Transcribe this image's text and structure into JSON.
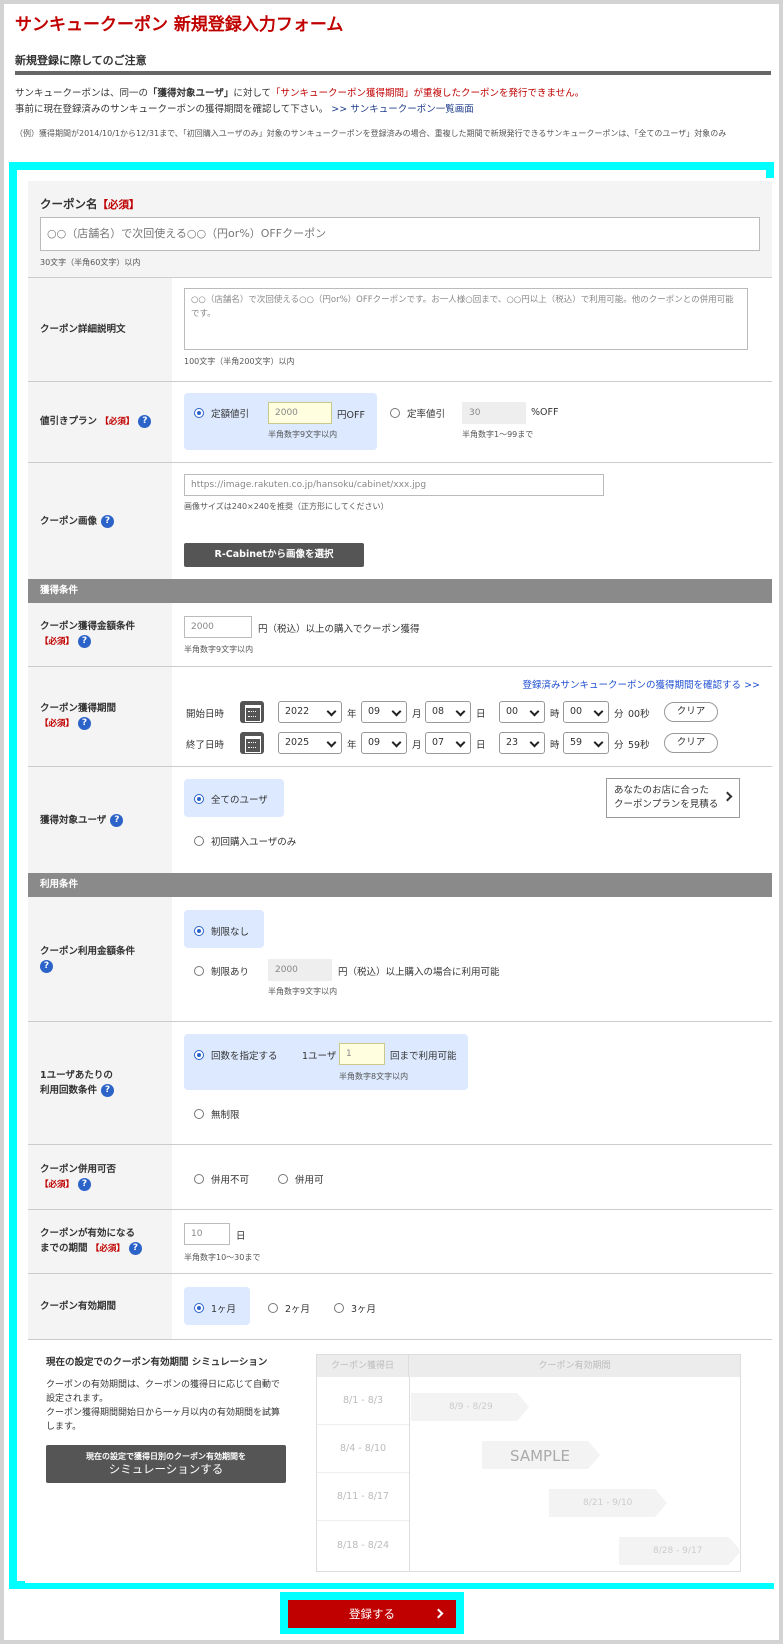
{
  "title": "サンキュークーポン 新規登録入力フォーム",
  "notice": {
    "heading": "新規登録に際してのご注意",
    "l1_a": "サンキュークーポンは、同一の",
    "l1_b": "「獲得対象ユーザ」",
    "l1_c": "に対して",
    "l1_d": "「サンキュークーポン獲得期間」が重複したクーポンを発行できません。",
    "l2_a": "事前に現在登録済みのサンキュークーポンの獲得期間を確認して下さい。",
    "l2_link": ">> サンキュークーポン一覧画面",
    "example": "（例）獲得期間が2014/10/1から12/31まで、「初回購入ユーザのみ」対象のサンキュークーポンを登録済みの場合、重複した期間で新規発行できるサンキュークーポンは、「全てのユーザ」対象のみ"
  },
  "coupon_name": {
    "label": "クーポン名",
    "req": "【必須】",
    "placeholder": "○○（店舗名）で次回使える○○（円or%）OFFクーポン",
    "hint": "30文字（半角60文字）以内"
  },
  "detail": {
    "label": "クーポン詳細説明文",
    "placeholder": "○○（店舗名）で次回使える○○（円or%）OFFクーポンです。お一人様○回まで、○○円以上（税込）で利用可能。他のクーポンとの併用可能です。",
    "hint": "100文字（半角200文字）以内"
  },
  "discount": {
    "label": "値引きプラン",
    "req": "【必須】",
    "fixed_label": "定額値引",
    "fixed_value": "2000",
    "fixed_unit": "円OFF",
    "fixed_hint": "半角数字9文字以内",
    "rate_label": "定率値引",
    "rate_value": "30",
    "rate_unit": "%OFF",
    "rate_hint": "半角数字1～99まで"
  },
  "image": {
    "label": "クーポン画像",
    "url": "https://image.rakuten.co.jp/hansoku/cabinet/xxx.jpg",
    "hint": "画像サイズは240×240を推奨（正方形にしてください）",
    "button": "R-Cabinetから画像を選択"
  },
  "acq_bar": "獲得条件",
  "amount": {
    "label": "クーポン獲得金額条件",
    "req": "【必須】",
    "value": "2000",
    "suffix": "円（税込）以上の購入でクーポン獲得",
    "hint": "半角数字9文字以内"
  },
  "period": {
    "label": "クーポン獲得期間",
    "req": "【必須】",
    "link": "登録済みサンキュークーポンの獲得期間を確認する >>",
    "start_label": "開始日時",
    "end_label": "終了日時",
    "start": {
      "year": "2022",
      "month": "09",
      "day": "08",
      "hour": "00",
      "min": "00",
      "sec": "00秒"
    },
    "end": {
      "year": "2025",
      "month": "09",
      "day": "07",
      "hour": "23",
      "min": "59",
      "sec": "59秒"
    },
    "u_year": "年",
    "u_month": "月",
    "u_day": "日",
    "u_hour": "時",
    "u_min": "分",
    "clear": "クリア"
  },
  "target": {
    "label": "獲得対象ユーザ",
    "opt_all": "全てのユーザ",
    "opt_first": "初回購入ユーザのみ",
    "estimate_l1": "あなたのお店に合った",
    "estimate_l2": "クーポンプランを見積る"
  },
  "use_bar": "利用条件",
  "use_amount": {
    "label": "クーポン利用金額条件",
    "opt_none": "制限なし",
    "opt_limit": "制限あり",
    "value": "2000",
    "suffix": "円（税込）以上購入の場合に利用可能",
    "hint": "半角数字9文字以内"
  },
  "use_count": {
    "label_l1": "1ユーザあたりの",
    "label_l2": "利用回数条件",
    "opt_count": "回数を指定する",
    "per_user": "1ユーザ",
    "value": "1",
    "suffix": "回まで利用可能",
    "hint": "半角数字8文字以内",
    "opt_unlimited": "無制限"
  },
  "combine": {
    "label": "クーポン併用可否",
    "req": "【必須】",
    "opt_no": "併用不可",
    "opt_yes": "併用可"
  },
  "start_days": {
    "label_l1": "クーポンが有効になる",
    "label_l2": "までの期間",
    "req": "【必須】",
    "value": "10",
    "unit": "日",
    "hint": "半角数字10～30まで"
  },
  "valid": {
    "label": "クーポン有効期間",
    "opt1": "1ヶ月",
    "opt2": "2ヶ月",
    "opt3": "3ヶ月"
  },
  "sim": {
    "heading": "現在の設定でのクーポン有効期間 シミュレーション",
    "desc1": "クーポンの有効期間は、クーポンの獲得日に応じて自動で設定されます。",
    "desc2": "クーポン獲得期間開始日から一ヶ月以内の有効期間を試算します。",
    "btn_l1": "現在の設定で獲得日別のクーポン有効期間を",
    "btn_l2": "シミュレーションする",
    "col1": "クーポン獲得日",
    "col2": "クーポン有効期間",
    "rows": [
      {
        "acq": "8/1 - 8/3",
        "valid": "8/9 - 8/29"
      },
      {
        "acq": "8/4 - 8/10",
        "valid": ""
      },
      {
        "acq": "8/11 - 8/17",
        "valid": "8/21 - 9/10"
      },
      {
        "acq": "8/18 - 8/24",
        "valid": "8/28 - 9/17"
      }
    ],
    "sample": "SAMPLE"
  },
  "submit": "登録する"
}
